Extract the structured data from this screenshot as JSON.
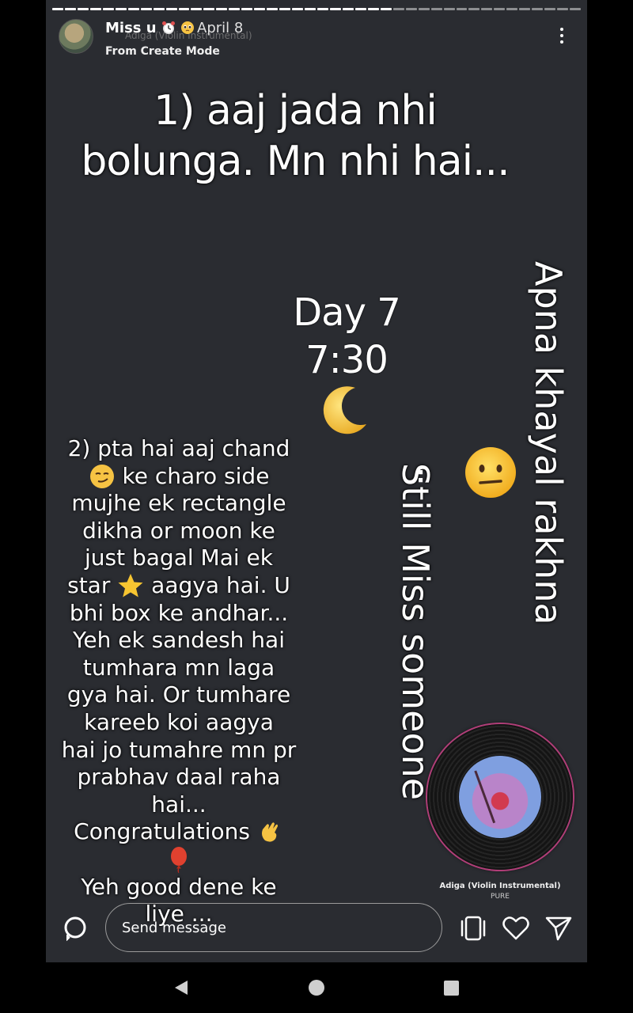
{
  "header": {
    "username": "Miss u",
    "date": "April 8",
    "subline": "From Create Mode",
    "ghost_text": "Adiga (Violin Instrumental)",
    "more_icon": "more-vertical-icon"
  },
  "story": {
    "heading_line1": "1) aaj jada nhi",
    "heading_line2": "bolunga. Mn nhi hai...",
    "day_line1": "Day 7",
    "day_line2": "7:30",
    "vertical_right": "Apna khayal rakhna",
    "vertical_middle": "Still Miss someone",
    "colon": ":",
    "body_lines": [
      "2) pta hai aaj chand",
      "ke charo side",
      "mujhe ek rectangle",
      "dikha or moon ke",
      "just bagal Mai ek",
      "star",
      "aagya hai. U",
      "bhi box ke andhar...",
      "Yeh ek sandesh hai",
      "tumhara mn laga",
      "gya hai. Or tumhare",
      "kareeb koi aagya",
      "hai jo tumahre mn pr",
      "prabhav daal raha",
      "hai...",
      "Congratulations",
      "Yeh good dene ke",
      "liye ..."
    ]
  },
  "music": {
    "song": "Adiga (Violin Instrumental)",
    "artist": "PURE"
  },
  "footer": {
    "placeholder": "Send message"
  },
  "colors": {
    "background": "#2a2c31",
    "accent_ring": "#b13e78"
  }
}
